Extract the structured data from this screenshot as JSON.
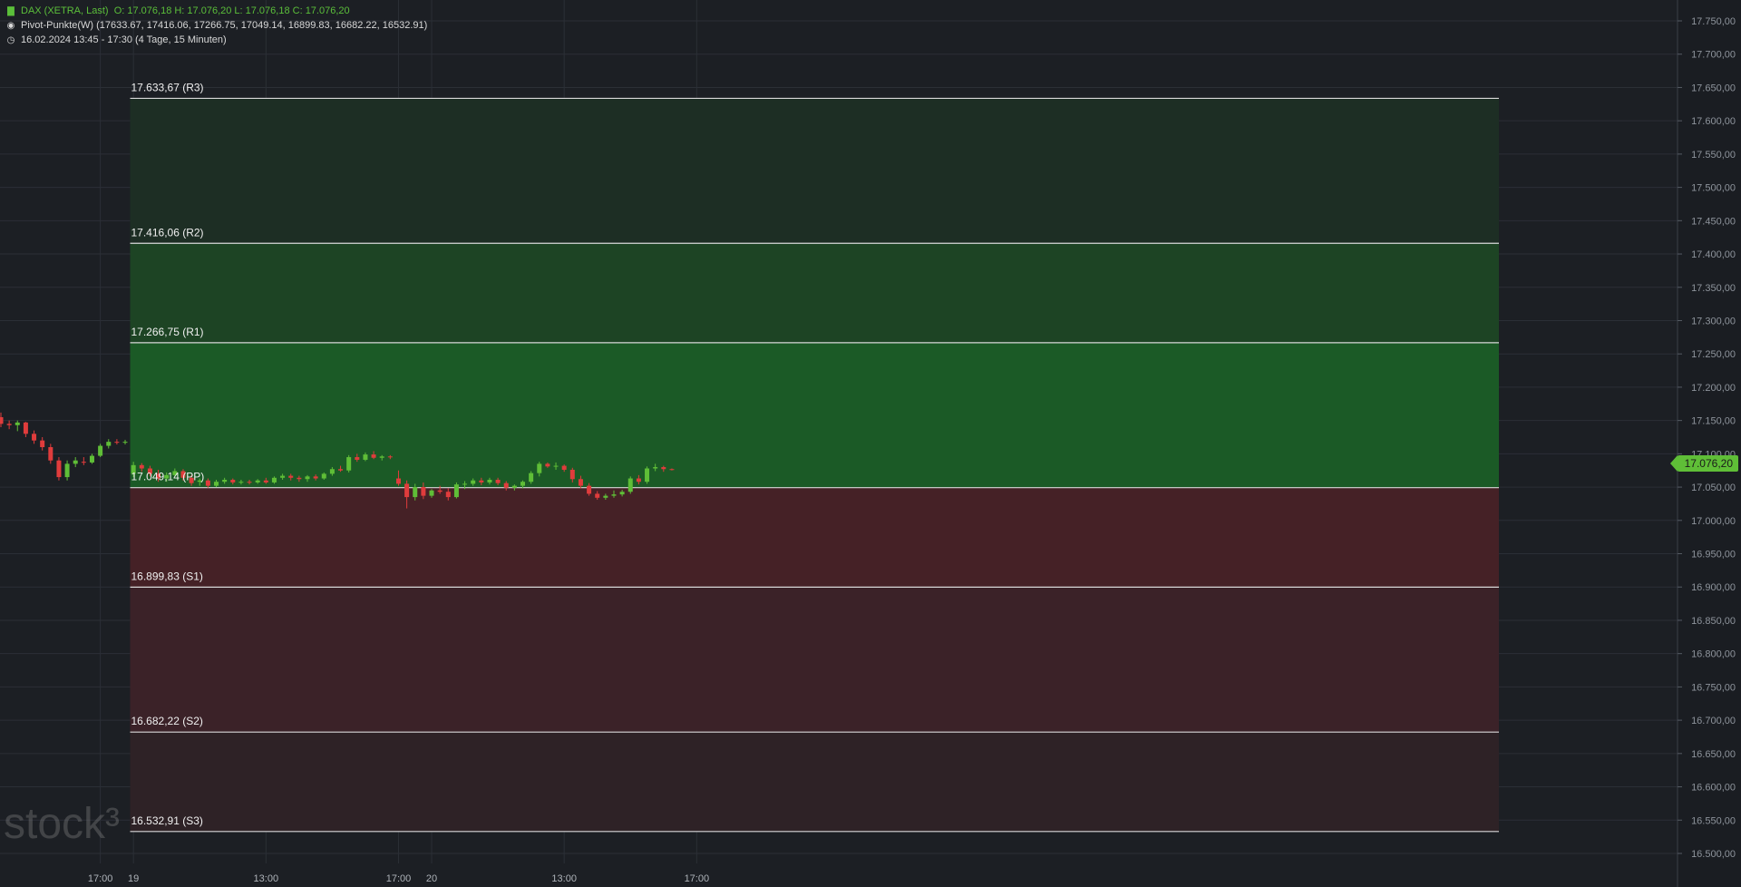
{
  "header": {
    "instrument": "DAX (XETRA, Last)",
    "ohlc": "O: 17.076,18  H: 17.076,20  L: 17.076,18  C: 17.076,20",
    "indicator": "Pivot-Punkte(W)  (17633.67,  17416.06,  17266.75,  17049.14,  16899.83,  16682.22,  16532.91)",
    "period": "16.02.2024 13:45 - 17:30   (4 Tage, 15 Minuten)",
    "icons": [
      "candlestick-icon",
      "target-icon",
      "clock-icon"
    ]
  },
  "watermark": "stock³",
  "last_price_label": "17.076,20",
  "colors": {
    "background": "#1c1f24",
    "up": "#5fbe37",
    "down": "#e03c3c",
    "grid": "#2b2f36",
    "resistance_zone": "#1b5a26",
    "support_zone": "#4a1d22",
    "level_line": "#d8d8d8"
  },
  "chart_data": {
    "type": "candlestick",
    "title": "DAX (XETRA, Last)",
    "subtitle": "16.02.2024 13:45 - 17:30   (4 Tage, 15 Minuten)",
    "ylim": [
      16485,
      17765
    ],
    "y_ticks": [
      16500,
      16550,
      16600,
      16650,
      16700,
      16750,
      16800,
      16850,
      16900,
      16950,
      17000,
      17050,
      17100,
      17150,
      17200,
      17250,
      17300,
      17350,
      17400,
      17450,
      17500,
      17550,
      17600,
      17650,
      17700,
      17750
    ],
    "y_tick_labels": [
      "16.500,00",
      "16.550,00",
      "16.600,00",
      "16.650,00",
      "16.700,00",
      "16.750,00",
      "16.800,00",
      "16.850,00",
      "16.900,00",
      "16.950,00",
      "17.000,00",
      "17.050,00",
      "17.100,00",
      "17.150,00",
      "17.200,00",
      "17.250,00",
      "17.300,00",
      "17.350,00",
      "17.400,00",
      "17.450,00",
      "17.500,00",
      "17.550,00",
      "17.600,00",
      "17.650,00",
      "17.700,00",
      "17.750,00"
    ],
    "x_ticks": [
      {
        "bar": 12,
        "label": "17:00"
      },
      {
        "bar": 16,
        "label": "19"
      },
      {
        "bar": 32,
        "label": "13:00"
      },
      {
        "bar": 48,
        "label": "17:00"
      },
      {
        "bar": 52,
        "label": "20"
      },
      {
        "bar": 68,
        "label": "13:00"
      },
      {
        "bar": 84,
        "label": "17:00"
      }
    ],
    "pivot_levels": [
      {
        "name": "R3",
        "value": 17633.67,
        "label": "17.633,67 (R3)"
      },
      {
        "name": "R2",
        "value": 17416.06,
        "label": "17.416,06 (R2)"
      },
      {
        "name": "R1",
        "value": 17266.75,
        "label": "17.266,75 (R1)"
      },
      {
        "name": "PP",
        "value": 17049.14,
        "label": "17.049,14 (PP)"
      },
      {
        "name": "S1",
        "value": 16899.83,
        "label": "16.899,83 (S1)"
      },
      {
        "name": "S2",
        "value": 16682.22,
        "label": "16.682,22 (S2)"
      },
      {
        "name": "S3",
        "value": 16532.91,
        "label": "16.532,91 (S3)"
      }
    ],
    "pivot_start_bar": 15.6,
    "candles": [
      [
        17155,
        17162,
        17140,
        17145
      ],
      [
        17145,
        17150,
        17137,
        17143
      ],
      [
        17143,
        17150,
        17134,
        17147
      ],
      [
        17147,
        17148,
        17125,
        17130
      ],
      [
        17130,
        17135,
        17115,
        17120
      ],
      [
        17120,
        17125,
        17105,
        17110
      ],
      [
        17110,
        17115,
        17085,
        17090
      ],
      [
        17090,
        17095,
        17060,
        17065
      ],
      [
        17065,
        17090,
        17060,
        17085
      ],
      [
        17085,
        17095,
        17080,
        17090
      ],
      [
        17088,
        17095,
        17083,
        17087
      ],
      [
        17087,
        17100,
        17085,
        17097
      ],
      [
        17097,
        17115,
        17095,
        17112
      ],
      [
        17112,
        17122,
        17108,
        17118
      ],
      [
        17118,
        17122,
        17114,
        17117
      ],
      [
        17117,
        17121,
        17114,
        17118
      ],
      [
        17070,
        17088,
        17065,
        17083
      ],
      [
        17083,
        17086,
        17073,
        17078
      ],
      [
        17078,
        17082,
        17066,
        17070
      ],
      [
        17070,
        17076,
        17058,
        17063
      ],
      [
        17063,
        17072,
        17058,
        17068
      ],
      [
        17068,
        17078,
        17065,
        17074
      ],
      [
        17074,
        17077,
        17060,
        17064
      ],
      [
        17064,
        17068,
        17052,
        17056
      ],
      [
        17058,
        17063,
        17052,
        17060
      ],
      [
        17060,
        17063,
        17049,
        17052
      ],
      [
        17052,
        17061,
        17050,
        17058
      ],
      [
        17058,
        17064,
        17055,
        17061
      ],
      [
        17061,
        17063,
        17054,
        17057
      ],
      [
        17057,
        17061,
        17054,
        17058
      ],
      [
        17058,
        17061,
        17054,
        17057
      ],
      [
        17057,
        17062,
        17055,
        17060
      ],
      [
        17060,
        17064,
        17055,
        17057
      ],
      [
        17057,
        17066,
        17055,
        17064
      ],
      [
        17064,
        17070,
        17061,
        17067
      ],
      [
        17067,
        17070,
        17060,
        17064
      ],
      [
        17064,
        17067,
        17058,
        17062
      ],
      [
        17062,
        17068,
        17058,
        17066
      ],
      [
        17066,
        17069,
        17060,
        17063
      ],
      [
        17063,
        17072,
        17061,
        17070
      ],
      [
        17070,
        17080,
        17067,
        17077
      ],
      [
        17077,
        17082,
        17073,
        17075
      ],
      [
        17075,
        17098,
        17072,
        17095
      ],
      [
        17095,
        17100,
        17088,
        17091
      ],
      [
        17091,
        17102,
        17089,
        17099
      ],
      [
        17099,
        17104,
        17092,
        17094
      ],
      [
        17094,
        17098,
        17090,
        17096
      ],
      [
        17096,
        17098,
        17092,
        17095
      ],
      [
        17063,
        17075,
        17052,
        17055
      ],
      [
        17055,
        17060,
        17018,
        17035
      ],
      [
        17035,
        17055,
        17030,
        17050
      ],
      [
        17050,
        17057,
        17032,
        17037
      ],
      [
        17037,
        17047,
        17034,
        17045
      ],
      [
        17045,
        17052,
        17040,
        17043
      ],
      [
        17043,
        17048,
        17030,
        17035
      ],
      [
        17035,
        17057,
        17033,
        17054
      ],
      [
        17054,
        17059,
        17047,
        17055
      ],
      [
        17055,
        17063,
        17052,
        17060
      ],
      [
        17060,
        17064,
        17053,
        17057
      ],
      [
        17057,
        17064,
        17054,
        17061
      ],
      [
        17061,
        17064,
        17053,
        17056
      ],
      [
        17056,
        17059,
        17045,
        17049
      ],
      [
        17049,
        17054,
        17045,
        17052
      ],
      [
        17052,
        17060,
        17048,
        17058
      ],
      [
        17058,
        17074,
        17055,
        17071
      ],
      [
        17071,
        17088,
        17066,
        17085
      ],
      [
        17085,
        17087,
        17079,
        17081
      ],
      [
        17081,
        17087,
        17076,
        17082
      ],
      [
        17082,
        17084,
        17073,
        17076
      ],
      [
        17076,
        17079,
        17057,
        17062
      ],
      [
        17062,
        17067,
        17048,
        17052
      ],
      [
        17052,
        17056,
        17037,
        17040
      ],
      [
        17040,
        17044,
        17031,
        17034
      ],
      [
        17034,
        17040,
        17031,
        17037
      ],
      [
        17037,
        17045,
        17034,
        17039
      ],
      [
        17039,
        17046,
        17036,
        17043
      ],
      [
        17043,
        17066,
        17040,
        17063
      ],
      [
        17063,
        17068,
        17054,
        17058
      ],
      [
        17058,
        17081,
        17055,
        17078
      ],
      [
        17078,
        17085,
        17074,
        17080
      ],
      [
        17080,
        17082,
        17073,
        17077
      ],
      [
        17077,
        17078,
        17075,
        17076
      ]
    ]
  }
}
